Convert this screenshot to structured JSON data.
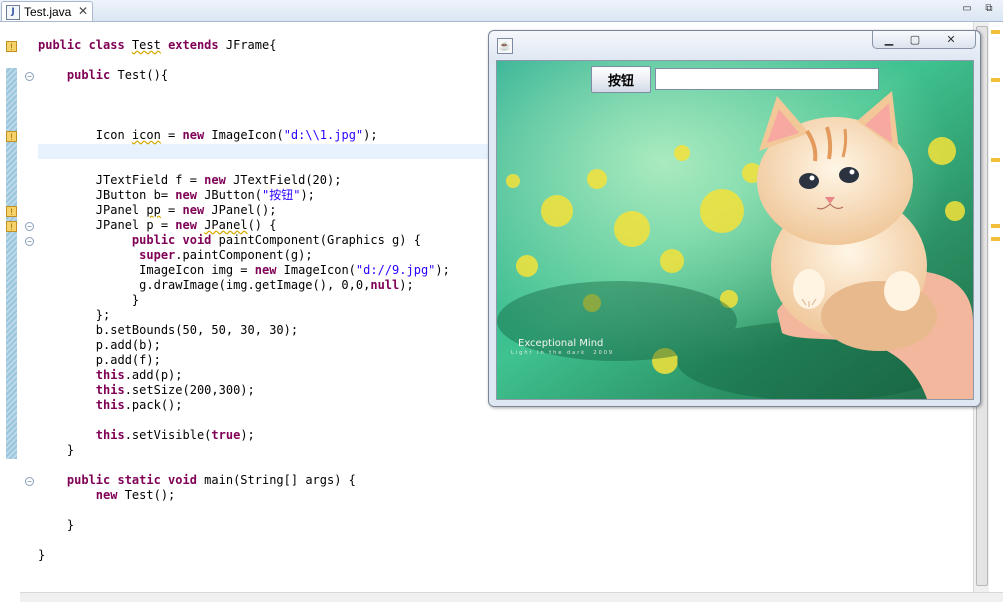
{
  "editor": {
    "tab": {
      "icon": "J",
      "label": "Test.java",
      "close": "✕"
    },
    "window_controls": {
      "minimize": "▭",
      "maximize": "⧉"
    },
    "code": [
      [
        {
          "t": "public class ",
          "c": "kw"
        },
        {
          "t": "Test",
          "c": "warn"
        },
        {
          "t": " "
        },
        {
          "t": "extends",
          "c": "kw"
        },
        {
          "t": " JFrame{"
        }
      ],
      [],
      [
        {
          "t": "    "
        },
        {
          "t": "public",
          "c": "kw"
        },
        {
          "t": " Test(){"
        }
      ],
      [],
      [],
      [],
      [
        {
          "t": "        Icon "
        },
        {
          "t": "icon",
          "c": "warn"
        },
        {
          "t": " = "
        },
        {
          "t": "new",
          "c": "kw"
        },
        {
          "t": " ImageIcon("
        },
        {
          "t": "\"d:\\\\1.jpg\"",
          "c": "str"
        },
        {
          "t": ");"
        }
      ],
      [],
      [],
      [
        {
          "t": "        JTextField f = "
        },
        {
          "t": "new",
          "c": "kw"
        },
        {
          "t": " JTextField(20);"
        }
      ],
      [
        {
          "t": "        JButton b= "
        },
        {
          "t": "new",
          "c": "kw"
        },
        {
          "t": " JButton("
        },
        {
          "t": "\"按钮\"",
          "c": "str"
        },
        {
          "t": ");"
        }
      ],
      [
        {
          "t": "        JPanel "
        },
        {
          "t": "pp",
          "c": "warn"
        },
        {
          "t": " = "
        },
        {
          "t": "new",
          "c": "kw"
        },
        {
          "t": " JPanel();"
        }
      ],
      [
        {
          "t": "        JPanel p = "
        },
        {
          "t": "new",
          "c": "kw"
        },
        {
          "t": " "
        },
        {
          "t": "JPanel",
          "c": "warn"
        },
        {
          "t": "() {"
        }
      ],
      [
        {
          "t": "             "
        },
        {
          "t": "public void",
          "c": "kw"
        },
        {
          "t": " paintComponent(Graphics g) {"
        }
      ],
      [
        {
          "t": "              "
        },
        {
          "t": "super",
          "c": "kw"
        },
        {
          "t": ".paintComponent(g);"
        }
      ],
      [
        {
          "t": "              ImageIcon img = "
        },
        {
          "t": "new",
          "c": "kw"
        },
        {
          "t": " ImageIcon("
        },
        {
          "t": "\"d://9.jpg\"",
          "c": "str"
        },
        {
          "t": ");"
        }
      ],
      [
        {
          "t": "              g.drawImage(img.getImage(), 0,0,"
        },
        {
          "t": "null",
          "c": "kw"
        },
        {
          "t": ");"
        }
      ],
      [
        {
          "t": "             }"
        }
      ],
      [
        {
          "t": "        };"
        }
      ],
      [
        {
          "t": "        b.setBounds(50, 50, 30, 30);"
        }
      ],
      [
        {
          "t": "        p.add(b);"
        }
      ],
      [
        {
          "t": "        p.add(f);"
        }
      ],
      [
        {
          "t": "        "
        },
        {
          "t": "this",
          "c": "kw"
        },
        {
          "t": ".add(p);"
        }
      ],
      [
        {
          "t": "        "
        },
        {
          "t": "this",
          "c": "kw"
        },
        {
          "t": ".setSize(200,300);"
        }
      ],
      [
        {
          "t": "        "
        },
        {
          "t": "this",
          "c": "kw"
        },
        {
          "t": ".pack();"
        }
      ],
      [],
      [
        {
          "t": "        "
        },
        {
          "t": "this",
          "c": "kw"
        },
        {
          "t": ".setVisible("
        },
        {
          "t": "true",
          "c": "kw"
        },
        {
          "t": ");"
        }
      ],
      [
        {
          "t": "    }"
        }
      ],
      [],
      [
        {
          "t": "    "
        },
        {
          "t": "public static void",
          "c": "kw"
        },
        {
          "t": " main(String[] args) {"
        }
      ],
      [
        {
          "t": "        "
        },
        {
          "t": "new",
          "c": "kw"
        },
        {
          "t": " Test();"
        }
      ],
      [],
      [
        {
          "t": "    }"
        }
      ],
      [],
      [
        {
          "t": "}"
        }
      ]
    ]
  },
  "jframe": {
    "icon": "☕",
    "controls": {
      "minimize": "▁",
      "maximize": "▢",
      "close": "✕"
    },
    "button_label": "按钮",
    "textfield_value": "",
    "watermark_title": "Exceptional Mind",
    "watermark_subtitle": "Light in the dark",
    "watermark_tag": "2009"
  },
  "colors": {
    "keyword": "#7f0055",
    "string": "#2a00ff",
    "current_line": "#e8f2fe",
    "warning": "#d8a800"
  }
}
